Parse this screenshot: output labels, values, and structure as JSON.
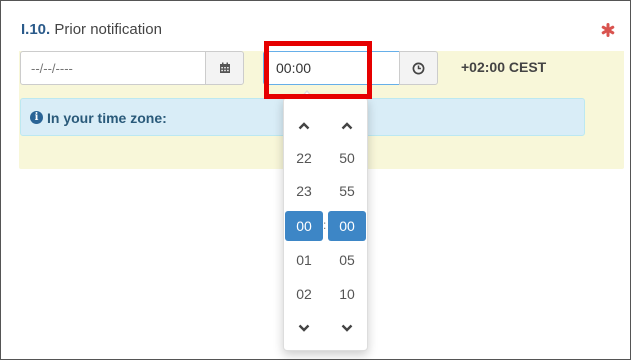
{
  "section": {
    "number": "I.10.",
    "title": "Prior notification",
    "required_color": "#d9534f"
  },
  "date": {
    "placeholder": "--/--/----"
  },
  "time": {
    "value": "00:00",
    "timezone": "+02:00 CEST"
  },
  "info": {
    "text": "In your time zone:"
  },
  "picker": {
    "hours": [
      "22",
      "23",
      "00",
      "01",
      "02"
    ],
    "minutes": [
      "50",
      "55",
      "00",
      "05",
      "10"
    ],
    "selected_hour": "00",
    "selected_minute": "00",
    "separator": ":"
  },
  "colors": {
    "accent": "#3d86c6",
    "highlight": "#e60000",
    "panel": "#f8f7d9",
    "info_bg": "#d9edf7"
  }
}
